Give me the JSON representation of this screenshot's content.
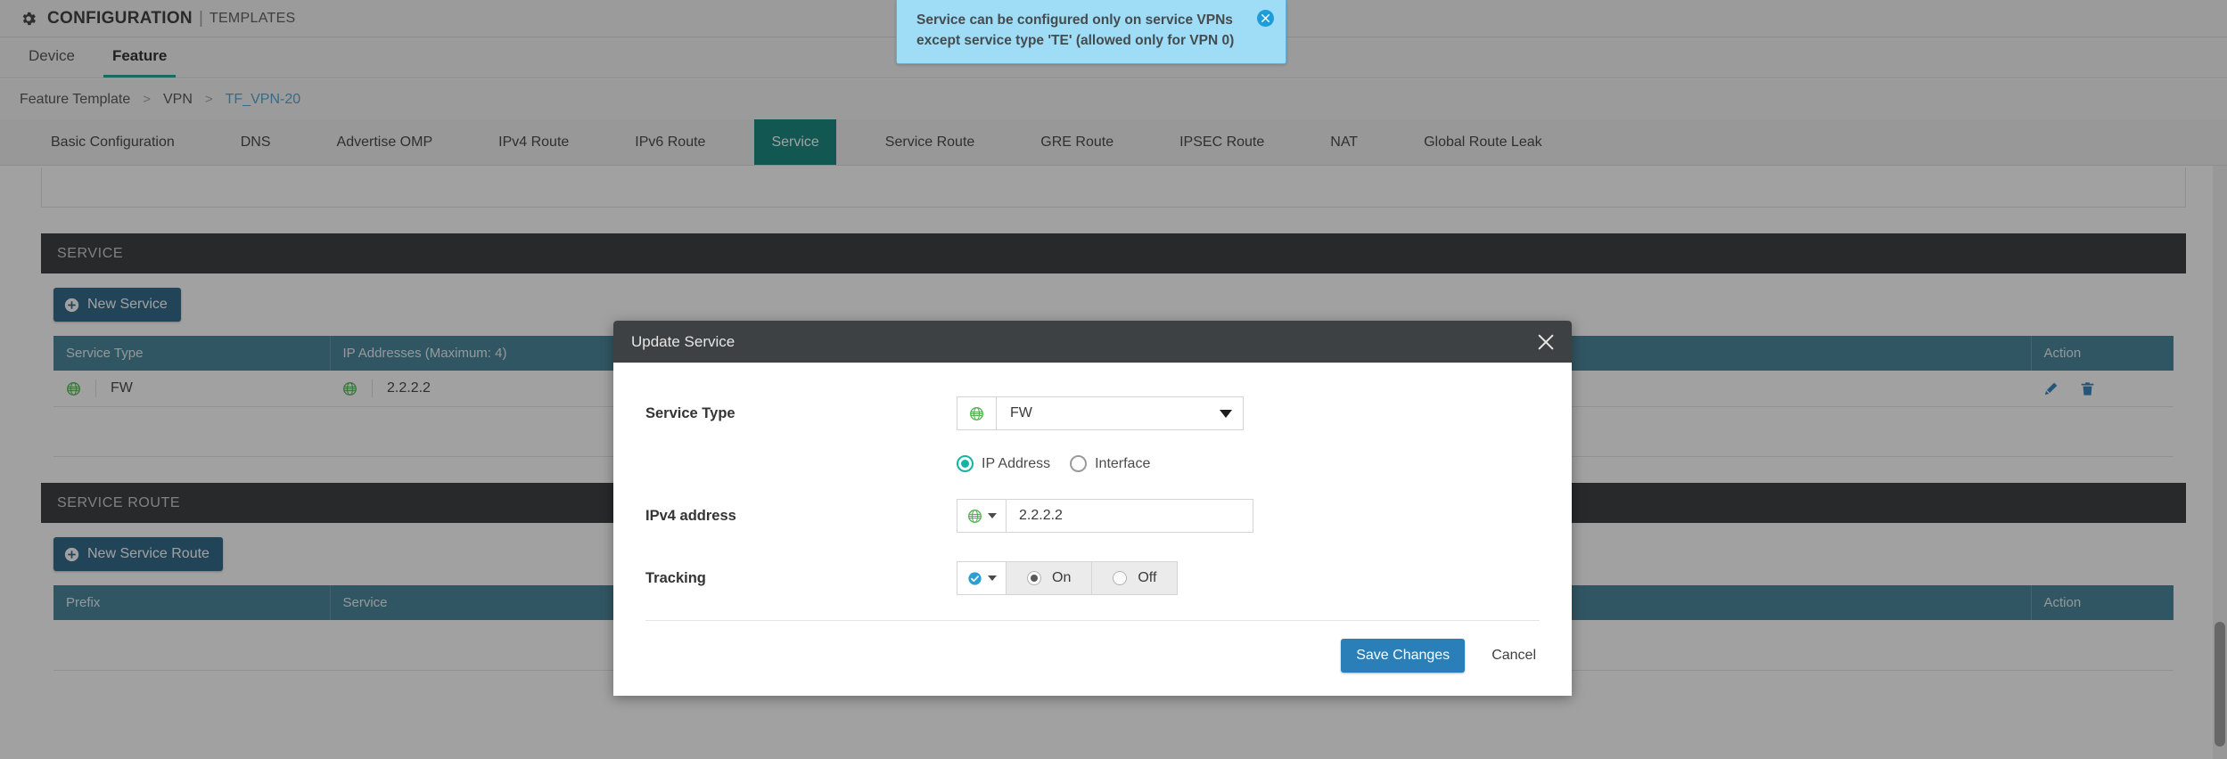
{
  "header": {
    "icon": "gear-icon",
    "title": "CONFIGURATION",
    "separator": "|",
    "subtitle": "TEMPLATES"
  },
  "top_tabs": [
    {
      "label": "Device",
      "active": false
    },
    {
      "label": "Feature",
      "active": true
    }
  ],
  "breadcrumb": {
    "items": [
      {
        "label": "Feature Template",
        "link": false
      },
      {
        "label": "VPN",
        "link": false
      },
      {
        "label": "TF_VPN-20",
        "link": true
      }
    ],
    "separator": ">"
  },
  "sub_tabs": [
    {
      "label": "Basic Configuration",
      "active": false
    },
    {
      "label": "DNS",
      "active": false
    },
    {
      "label": "Advertise OMP",
      "active": false
    },
    {
      "label": "IPv4 Route",
      "active": false
    },
    {
      "label": "IPv6 Route",
      "active": false
    },
    {
      "label": "Service",
      "active": true
    },
    {
      "label": "Service Route",
      "active": false
    },
    {
      "label": "GRE Route",
      "active": false
    },
    {
      "label": "IPSEC Route",
      "active": false
    },
    {
      "label": "NAT",
      "active": false
    },
    {
      "label": "Global Route Leak",
      "active": false
    }
  ],
  "toast": {
    "message": "Service can be configured only on service VPNs except service type 'TE' (allowed only for VPN 0)",
    "close_icon": "close-icon",
    "background_color": "#9fdcf5",
    "close_button_color": "#1d9ed9"
  },
  "service_section": {
    "title": "SERVICE",
    "new_button_label": "New Service",
    "columns": [
      "Service Type",
      "IP Addresses (Maximum: 4)",
      "Action"
    ],
    "rows": [
      {
        "service_type": "FW",
        "service_type_scope_icon": "globe-icon",
        "ip_addresses": "2.2.2.2",
        "ip_scope_icon": "globe-icon",
        "actions": [
          "edit-icon",
          "delete-icon"
        ]
      }
    ]
  },
  "service_route_section": {
    "title": "SERVICE ROUTE",
    "new_button_label": "New Service Route",
    "columns": [
      "Prefix",
      "Service",
      "Action"
    ],
    "rows": []
  },
  "modal": {
    "title": "Update Service",
    "close_icon": "close-icon",
    "fields": {
      "service_type": {
        "label": "Service Type",
        "scope_icon": "globe-icon",
        "value": "FW"
      },
      "address_mode": {
        "options": [
          {
            "label": "IP Address",
            "selected": true
          },
          {
            "label": "Interface",
            "selected": false
          }
        ]
      },
      "ipv4_address": {
        "label": "IPv4 address",
        "scope_icon": "globe-icon",
        "value": "2.2.2.2",
        "placeholder": ""
      },
      "tracking": {
        "label": "Tracking",
        "scope_icon": "check-icon",
        "options": [
          {
            "label": "On",
            "selected": true
          },
          {
            "label": "Off",
            "selected": false
          }
        ]
      }
    },
    "footer": {
      "save_label": "Save Changes",
      "cancel_label": "Cancel"
    }
  },
  "colors": {
    "accent_teal": "#0c8077",
    "table_header": "#3f7f95",
    "section_header": "#2e3132",
    "primary_button": "#2a7fb8",
    "new_button": "#245f84",
    "radio_selected": "#15b2a6",
    "link": "#4b9fd5"
  }
}
